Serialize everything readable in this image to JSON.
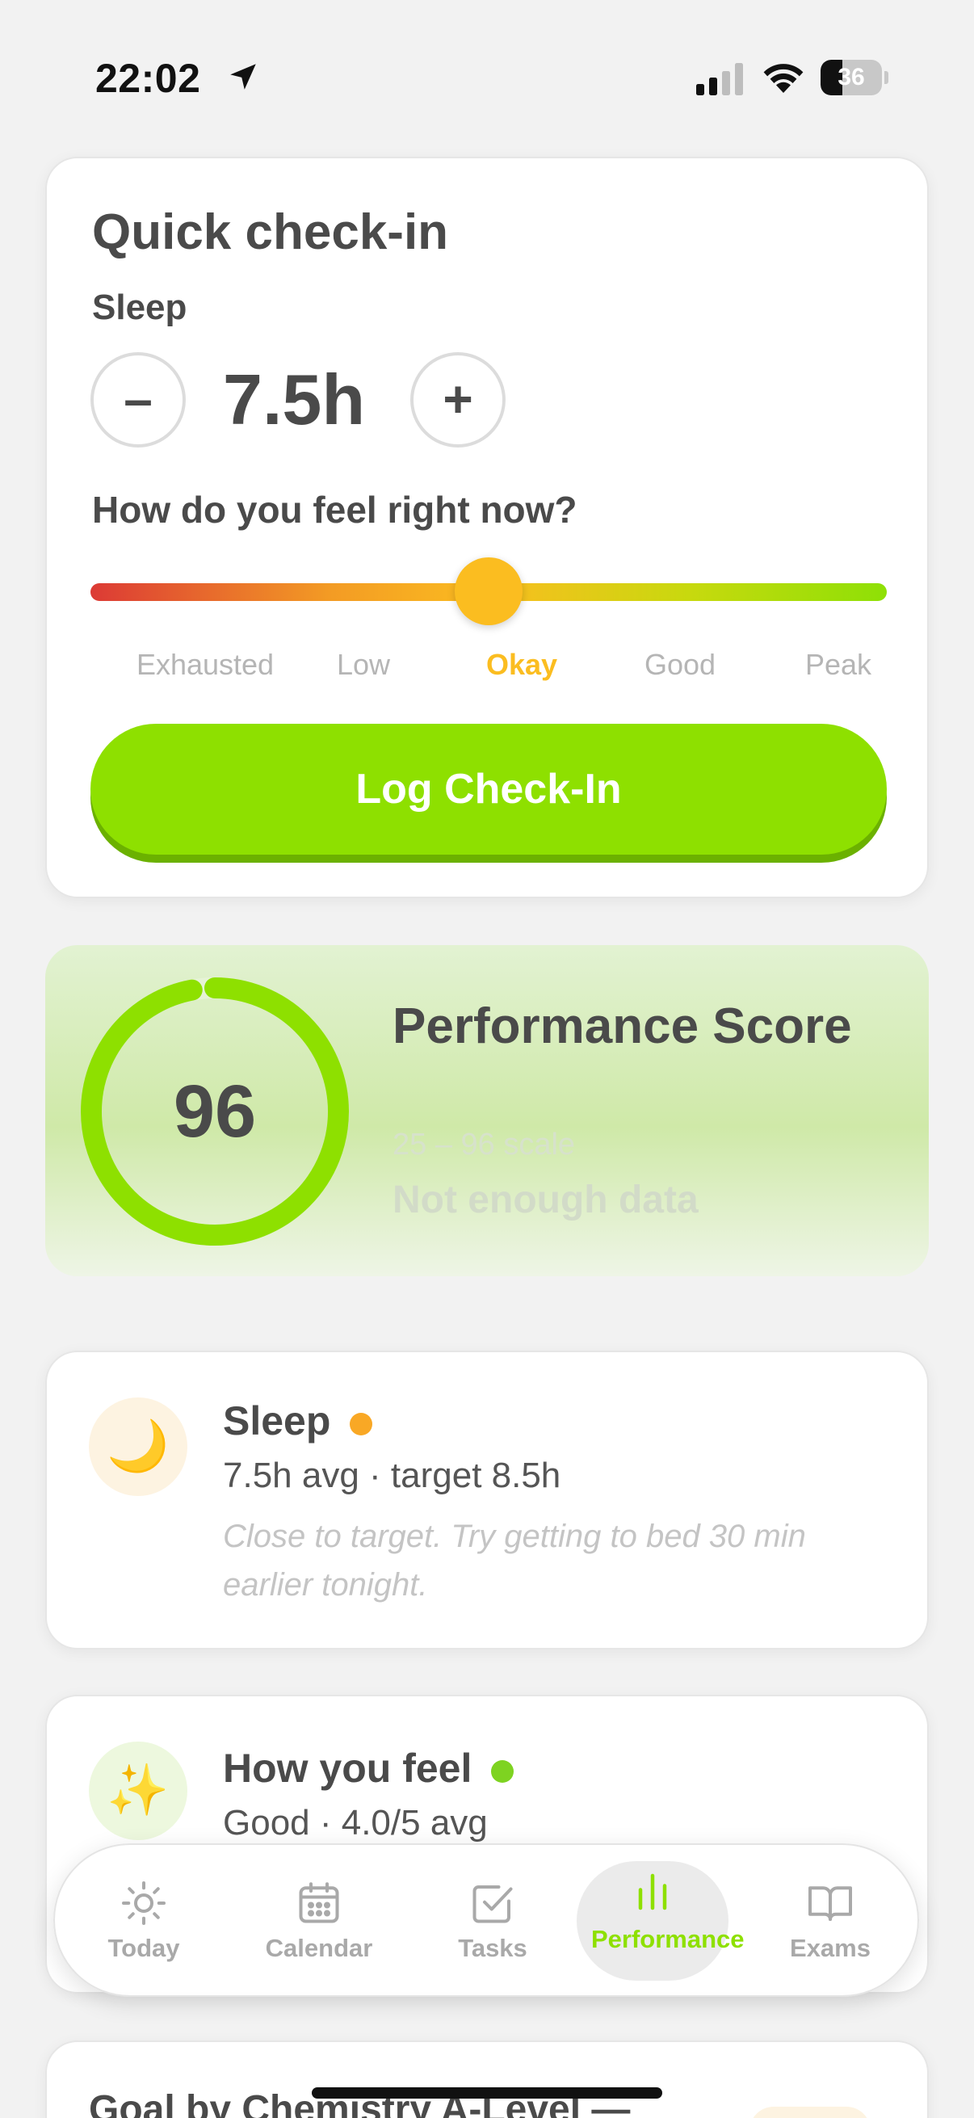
{
  "status_bar": {
    "time": "22:02",
    "battery": "36",
    "battery_level": 0.36
  },
  "checkin": {
    "title": "Quick check-in",
    "sleep_label": "Sleep",
    "minus_label": "–",
    "plus_label": "+",
    "sleep_value": "7.5h",
    "feel_question": "How do you feel right now?",
    "mood_options": [
      "Exhausted",
      "Low",
      "Okay",
      "Good",
      "Peak"
    ],
    "selected_mood_index": 2,
    "slider_value": 0.5,
    "button_label": "Log Check-In"
  },
  "performance": {
    "score": "96",
    "score_fraction": 0.97,
    "title": "Performance Score",
    "scale": "25 – 96 scale",
    "status": "Not enough data"
  },
  "sleep_card": {
    "icon": "🌙",
    "title": "Sleep",
    "status_color": "#f9a825",
    "summary": "7.5h avg · target 8.5h",
    "note": "Close to target. Try getting to bed 30 min earlier tonight."
  },
  "feel_card": {
    "icon": "✨",
    "title": "How you feel",
    "status_color": "#7ed321",
    "summary": "Good · 4.0/5 avg"
  },
  "goal_card": {
    "title": "Goal by Chemistry A-Level —"
  },
  "tabbar": {
    "tabs": [
      {
        "label": "Today",
        "icon": "sun-icon"
      },
      {
        "label": "Calendar",
        "icon": "calendar-icon"
      },
      {
        "label": "Tasks",
        "icon": "checkbox-icon"
      },
      {
        "label": "Performance",
        "icon": "bar-chart-icon"
      },
      {
        "label": "Exams",
        "icon": "book-icon"
      }
    ],
    "active_index": 3,
    "accent_color": "#8ee000"
  }
}
